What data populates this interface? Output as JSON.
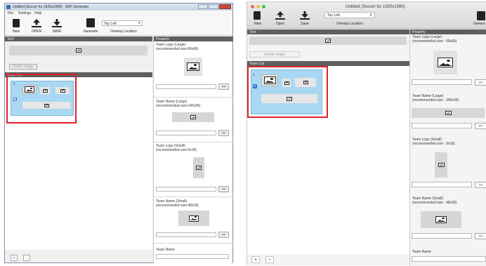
{
  "win": {
    "title": "Untitled [Soccer for 1920x1080] - SDP Generator",
    "menu": [
      "File",
      "Settings",
      "Help"
    ],
    "toolbar": {
      "new": "New",
      "open": "OPEN",
      "save": "SAVE",
      "generate": "Generate",
      "location_value": "Top Left",
      "location_label": "Overlay Location"
    },
    "text_header": "Text",
    "delete_image": "Delete Image",
    "team_list_header": "Team List",
    "item_number": "1",
    "property_header": "Property",
    "properties": [
      {
        "label": "Team Logo (Large)\n(recommended size:66x66)"
      },
      {
        "label": "Team Name (Large)\n(recommended size:240x36)"
      },
      {
        "label": "Team Logo (Small)\n(recommended size:9x18)"
      },
      {
        "label": "Team Name (Small)\n(recommended size:48x18)"
      },
      {
        "label": "Team Name"
      }
    ],
    "browse": ">>",
    "add": "+",
    "remove": "-"
  },
  "mac": {
    "title": "Untitled (Soccer for 1920x1080)",
    "toolbar": {
      "new": "New",
      "open": "Open",
      "save": "Save",
      "location_value": "Top Left",
      "location_label": "Overlay Location",
      "generate": "Genera"
    },
    "text_header": "Text",
    "delete_image": "Delete Image",
    "team_list_header": "Team List",
    "item_number": "1",
    "property_header": "Property",
    "properties": [
      {
        "label": "Team Logo (Large)\n(recommended size : 66x66)"
      },
      {
        "label": "Team Name (Large)\n(recommended size : 240x36)"
      },
      {
        "label": "Team Logo (Small)\n(recommended size : 9x18)"
      },
      {
        "label": "Team Name (Small)\n(recommended size : 48x18)"
      },
      {
        "label": "Team Name"
      }
    ],
    "browse": ">>",
    "add": "+",
    "remove": "−"
  },
  "colors": {
    "highlight": "#e0212b",
    "selection": "#a9d8f3",
    "header_dark": "#5f5f5f"
  }
}
